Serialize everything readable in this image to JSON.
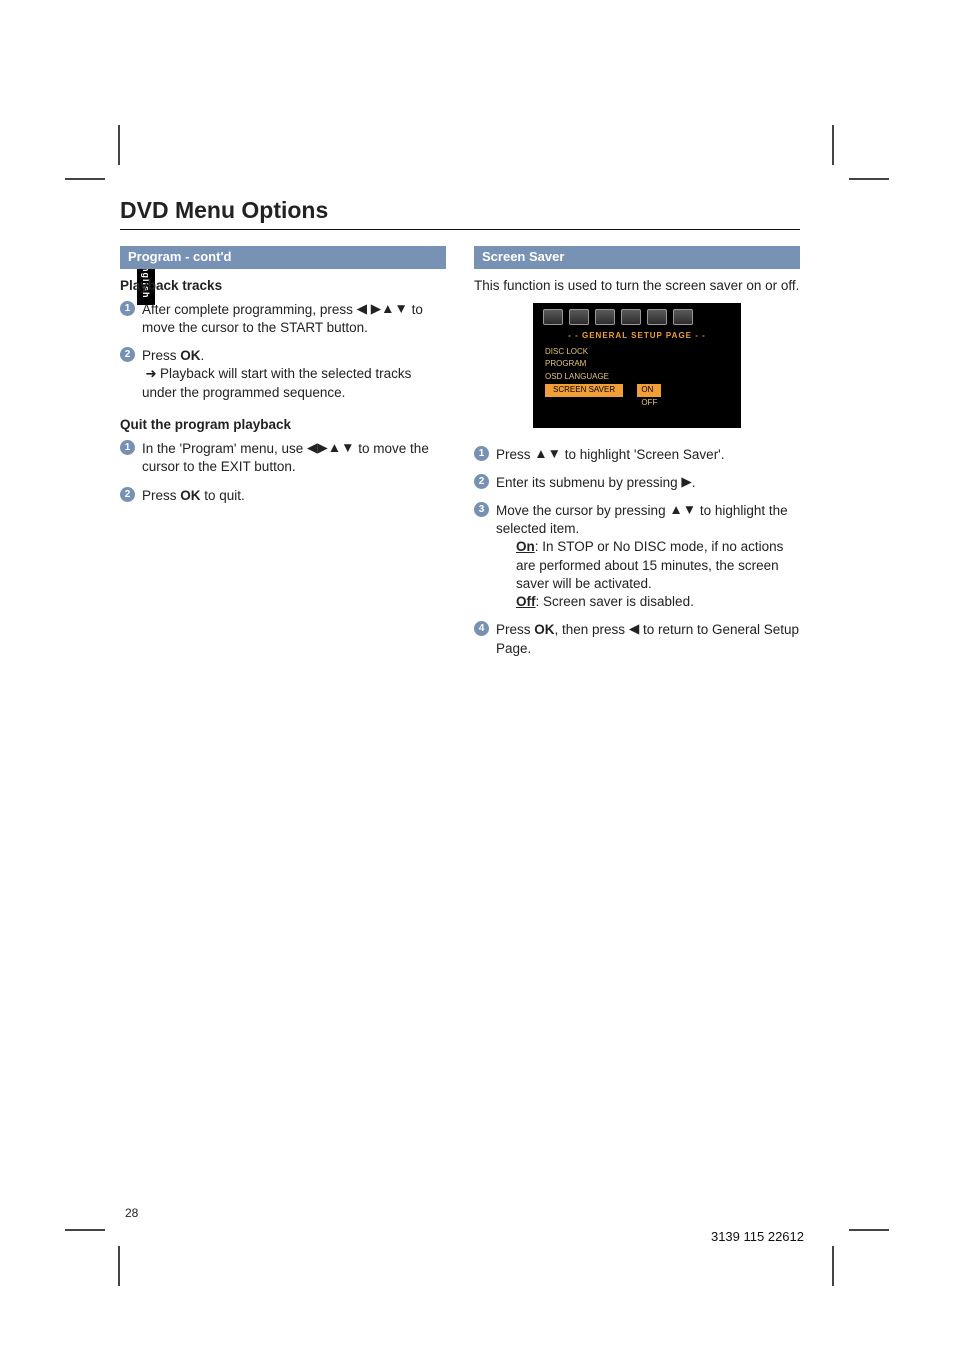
{
  "side_tab": "English",
  "title": "DVD Menu Options",
  "page_number": "28",
  "footer_code": "3139 115 22612",
  "arrows": {
    "left": "◀",
    "right": "▶",
    "up": "▲",
    "down": "▼"
  },
  "left": {
    "section_head": "Program - cont'd",
    "pb_head": "Playback tracks",
    "pb_steps": {
      "s1a": "After complete programming, press ",
      "s1b": " to move the cursor to the START button.",
      "s2a": "Press ",
      "s2b": "OK",
      "s2c": ".",
      "s2_arrow_text": "Playback will start with the selected tracks under the programmed sequence."
    },
    "quit_head": "Quit the program playback",
    "quit_steps": {
      "s1a": "In the 'Program' menu, use ",
      "s1b": " to move the cursor to the EXIT button.",
      "s2a": "Press ",
      "s2b": "OK",
      "s2c": " to quit."
    }
  },
  "right": {
    "section_head": "Screen Saver",
    "intro": "This function is used to turn the screen saver on or off.",
    "osd": {
      "page_title": "- -   GENERAL  SETUP  PAGE   - -",
      "items": [
        "DISC LOCK",
        "PROGRAM",
        "OSD LANGUAGE"
      ],
      "hl_item": "SCREEN SAVER",
      "opts": [
        "ON",
        "OFF"
      ]
    },
    "steps": {
      "s1a": "Press ",
      "s1b": " to highlight 'Screen Saver'.",
      "s2a": "Enter its submenu by pressing ",
      "s2b": ".",
      "s3a": "Move the cursor by pressing ",
      "s3b": " to highlight the selected item.",
      "s3_on_label": "On",
      "s3_on_text": ": In STOP or No DISC mode, if no actions are performed about 15 minutes, the screen saver will be activated.",
      "s3_off_label": "Off",
      "s3_off_text": ": Screen saver is disabled.",
      "s4a": "Press ",
      "s4b": "OK",
      "s4c": ", then press ",
      "s4d": " to return to General Setup Page."
    }
  }
}
